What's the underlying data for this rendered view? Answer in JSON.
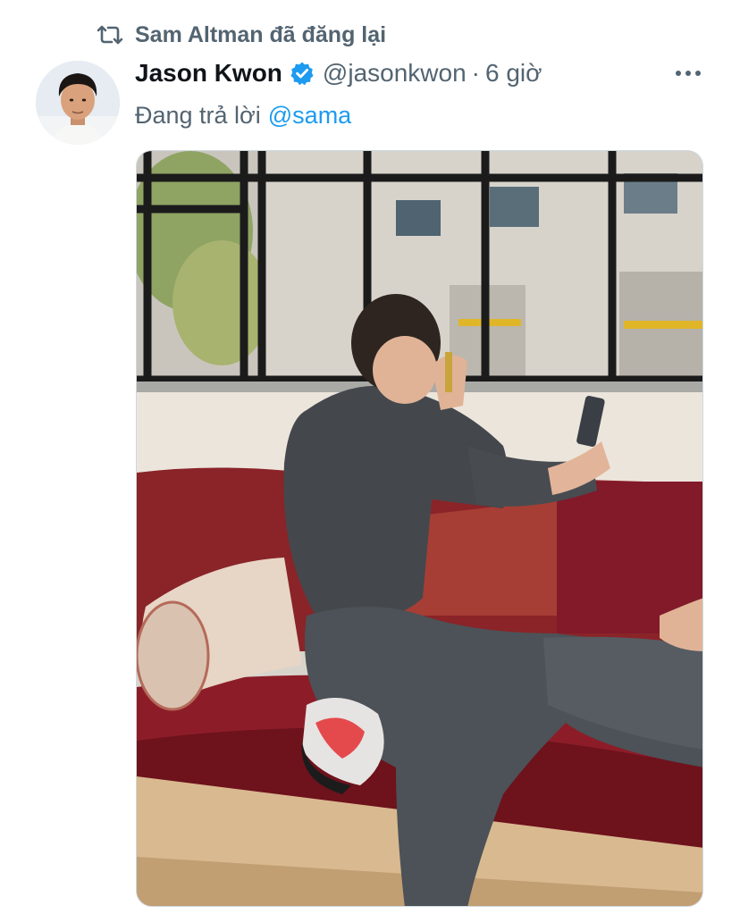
{
  "social_context": {
    "label": "Sam Altman đã đăng lại",
    "icon": "repost-icon"
  },
  "author": {
    "display_name": "Jason Kwon",
    "handle": "@jasonkwon",
    "separator": "·",
    "time": "6 giờ",
    "verified": true,
    "verified_color": "#1d9bf0"
  },
  "reply": {
    "prefix": "Đang trả lời",
    "mention": "@sama"
  },
  "colors": {
    "accent": "#1d9bf0",
    "secondary_text": "#536471",
    "primary_text": "#0f1419"
  }
}
